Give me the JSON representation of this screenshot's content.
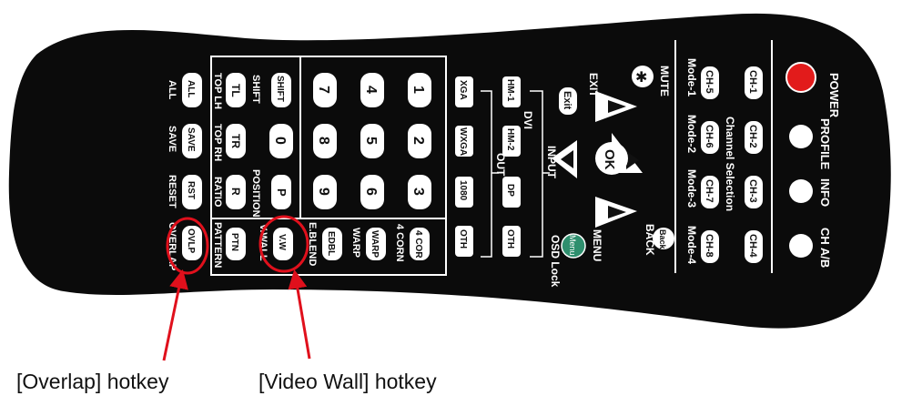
{
  "colors": {
    "body": "#0b0b0b",
    "key_fill": "#ffffff",
    "key_stroke": "#222222",
    "panel_line": "#ffffff",
    "power": "#e21b1b",
    "menu": "#2f8f6e",
    "highlight": "#e0101c",
    "background": "#ffffff"
  },
  "remote": {
    "power_label": "POWER",
    "profile_label": "PROFILE",
    "info_label": "INFO",
    "chab_label": "CH A/B",
    "channel_keys": [
      "CH-1",
      "CH-2",
      "CH-3",
      "CH-4",
      "CH-5",
      "CH-6",
      "CH-7",
      "CH-8"
    ],
    "channel_selection_label": "Channel Selection",
    "modes": [
      "Mode-1",
      "Mode-2",
      "Mode-3",
      "Mode-4"
    ],
    "mute_label": "MUTE",
    "exit_label": "EXIT",
    "exit_key": "Exit",
    "ok_key": "OK",
    "back_label": "BACK",
    "back_key": "Back",
    "menu_label": "MENU",
    "menu_key": "Menu",
    "osd_lock_label": "OSD Lock",
    "input_label": "INPUT",
    "dvi_label": "DVI",
    "input_keys": [
      "HM-1",
      "HM-2",
      "DP",
      "OTH"
    ],
    "out_label": "OUT",
    "out_keys": [
      "XGA",
      "WXGA",
      "1080",
      "OTH"
    ],
    "digits": [
      "1",
      "2",
      "3",
      "4",
      "5",
      "6",
      "7",
      "8",
      "9",
      "0"
    ],
    "shift_key": "SHIFT",
    "shift_label": "SHIFT",
    "p_key": "P",
    "position_label": "POSITION",
    "tl_key": "TL",
    "tr_key": "TR",
    "r_key": "R",
    "top_lh_label": "TOP LH",
    "top_rh_label": "TOP RH",
    "ratio_label": "RATIO",
    "all_key": "ALL",
    "save_key": "SAVE",
    "rst_key": "RST",
    "ovlp_key": "OVLP",
    "all_label": "ALL",
    "save_label": "SAVE",
    "reset_label": "RESET",
    "overlap_label": "OVERLAP",
    "ptn_key": "PTN",
    "pattern_label": "PATTERN",
    "vw_key": "V.W",
    "vwall_label": "V.WALL",
    "edbl_key": "EDBL",
    "eblend_label": "E.BLEND",
    "warp_key": "WARP",
    "warp_label": "WARP",
    "fourcor_key": "4 COR",
    "fourcorn_label": "4 CORN"
  },
  "callouts": {
    "overlap": "[Overlap] hotkey",
    "video_wall": "[Video Wall] hotkey"
  }
}
